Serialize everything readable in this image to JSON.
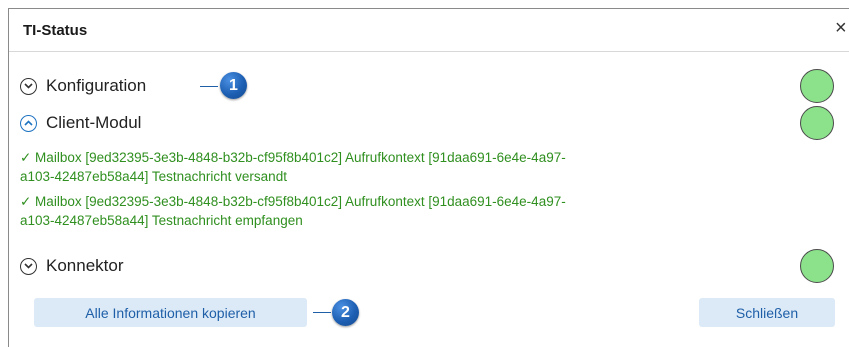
{
  "dialog": {
    "title": "TI-Status",
    "close_glyph": "×"
  },
  "sections": [
    {
      "label": "Konfiguration",
      "expanded": false,
      "status_color": "#8be28b"
    },
    {
      "label": "Client-Modul",
      "expanded": true,
      "status_color": "#8be28b"
    },
    {
      "label": "Konnektor",
      "expanded": false,
      "status_color": "#8be28b"
    }
  ],
  "client_log": [
    {
      "line1": "✓ Mailbox [9ed32395-3e3b-4848-b32b-cf95f8b401c2] Aufrufkontext [91daa691-6e4e-4a97-",
      "line2": "a103-42487eb58a44] Testnachricht versandt"
    },
    {
      "line1": "✓ Mailbox [9ed32395-3e3b-4848-b32b-cf95f8b401c2] Aufrufkontext [91daa691-6e4e-4a97-",
      "line2": "a103-42487eb58a44] Testnachricht empfangen"
    }
  ],
  "buttons": {
    "copy_label": "Alle Informationen kopieren",
    "close_label": "Schließen"
  },
  "callouts": [
    "1",
    "2"
  ],
  "colors": {
    "accent": "#1f74c2",
    "log_text": "#2f8f1f",
    "status_ok": "#8be28b",
    "button_bg": "#dceaf7"
  }
}
